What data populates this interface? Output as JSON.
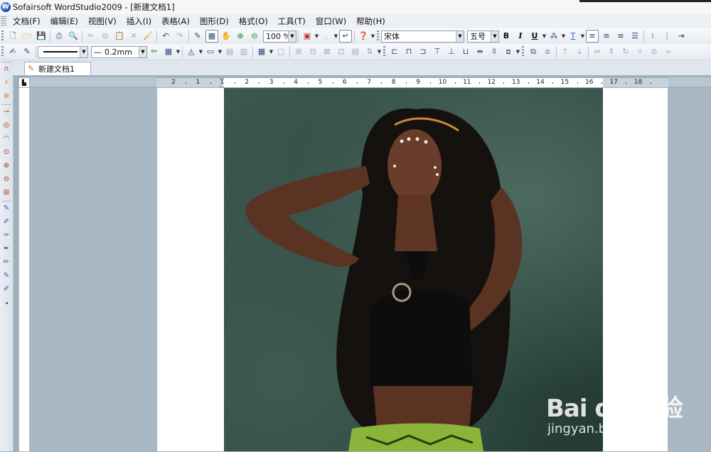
{
  "window": {
    "title": "Sofairsoft WordStudio2009 - [新建文档1]",
    "app_icon": "W"
  },
  "menu": {
    "items": [
      "文档(F)",
      "编辑(E)",
      "视图(V)",
      "插入(I)",
      "表格(A)",
      "图形(D)",
      "格式(O)",
      "工具(T)",
      "窗口(W)",
      "帮助(H)"
    ]
  },
  "toolbar1": {
    "zoom": "100 %",
    "font_name": "宋体",
    "font_size": "五号",
    "bold": "B",
    "italic": "I",
    "underline": "U"
  },
  "toolbar2": {
    "line_width": "0.2mm"
  },
  "tabs": [
    {
      "label": "新建文档1",
      "active": true
    }
  ],
  "ruler": {
    "labels": [
      "2",
      "1",
      "1",
      "2",
      "3",
      "4",
      "5",
      "6",
      "7",
      "8",
      "9",
      "10",
      "11",
      "12",
      "13",
      "14",
      "15",
      "16",
      "17",
      "18"
    ]
  },
  "watermark": {
    "brand": "Bai du 经验",
    "url": "jingyan.baidu.com"
  },
  "colors": {
    "workspace": "#a9b8c4",
    "photo_background": "#2f4a43",
    "ui_blue": "#2b4a78"
  }
}
